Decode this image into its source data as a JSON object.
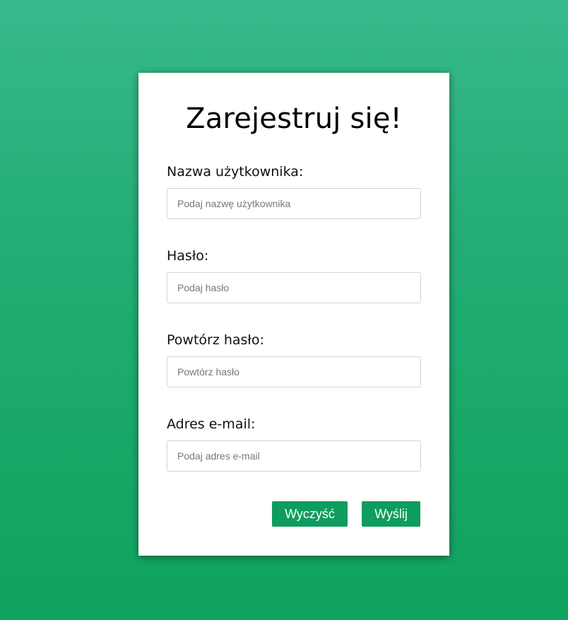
{
  "form": {
    "title": "Zarejestruj się!",
    "fields": [
      {
        "label": "Nazwa użytkownika:",
        "placeholder": "Podaj nazwę użytkownika",
        "value": ""
      },
      {
        "label": "Hasło:",
        "placeholder": "Podaj hasło",
        "value": ""
      },
      {
        "label": "Powtórz hasło:",
        "placeholder": "Powtórz hasło",
        "value": ""
      },
      {
        "label": "Adres e-mail:",
        "placeholder": "Podaj adres e-mail",
        "value": ""
      }
    ],
    "buttons": {
      "clear_label": "Wyczyść",
      "submit_label": "Wyślij"
    }
  },
  "colors": {
    "background_top": "#38b98c",
    "background_bottom": "#0fa35e",
    "button": "#0f9d5f",
    "card": "#ffffff"
  }
}
